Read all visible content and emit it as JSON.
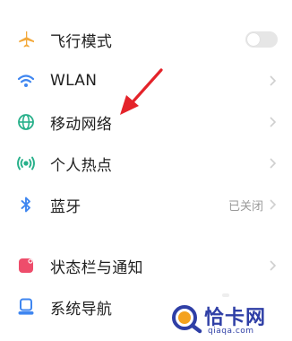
{
  "settings": {
    "items": [
      {
        "label": "飞行模式",
        "control": "toggle",
        "toggle_on": false,
        "icon": "airplane-icon"
      },
      {
        "label": "WLAN",
        "control": "chevron",
        "icon": "wifi-icon"
      },
      {
        "label": "移动网络",
        "control": "chevron",
        "icon": "globe-icon"
      },
      {
        "label": "个人热点",
        "control": "chevron",
        "icon": "hotspot-icon"
      },
      {
        "label": "蓝牙",
        "control": "chevron",
        "value": "已关闭",
        "icon": "bluetooth-icon"
      },
      {
        "label": "状态栏与通知",
        "control": "chevron",
        "icon": "notification-icon"
      },
      {
        "label": "系统导航",
        "control": "chevron",
        "icon": "navigation-icon"
      }
    ]
  },
  "annotation": {
    "arrow_color": "#e4232a"
  },
  "watermark": {
    "title": "恰卡网",
    "url": "qiaqa.com"
  },
  "colors": {
    "airplane": "#f3a93b",
    "wifi": "#3f86f0",
    "globe": "#27b08a",
    "hotspot": "#27b08a",
    "bluetooth": "#3f86f0",
    "notification": "#ee4d6b",
    "navigation": "#3f86f0",
    "watermark": "#2f3fa6"
  }
}
